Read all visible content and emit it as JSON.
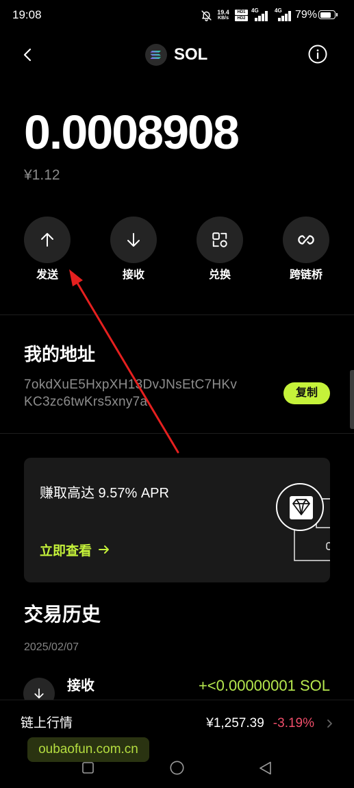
{
  "status_bar": {
    "time": "19:08",
    "net_speed": "19.4",
    "net_speed_unit": "KB/s",
    "hd_sim1": "HD1",
    "hd_sim2": "HD2",
    "sim1_network": "4G",
    "sim2_network": "4G",
    "battery_text": "79%",
    "battery_level_pct": 79,
    "icons": [
      "bell-off-icon",
      "signal-icon",
      "signal-icon",
      "battery-icon"
    ]
  },
  "header": {
    "back_icon": "chevron-left-icon",
    "token_icon": "solana-logo-icon",
    "title": "SOL",
    "info_icon": "info-icon"
  },
  "balance": {
    "amount": "0.0008908",
    "fiat_value": "¥1.12"
  },
  "actions": [
    {
      "label": "发送",
      "icon": "arrow-up-icon"
    },
    {
      "label": "接收",
      "icon": "arrow-down-icon"
    },
    {
      "label": "兑换",
      "icon": "swap-icon"
    },
    {
      "label": "跨链桥",
      "icon": "bridge-icon"
    }
  ],
  "address": {
    "title": "我的地址",
    "line1": "7okdXuE5HxpXH13DvJNsEtC7HKv",
    "line2": "KC3zc6twKrs5xny7a",
    "copy_label": "复制"
  },
  "promo": {
    "headline": "赚取高达 9.57% APR",
    "cta_label": "立即查看",
    "cta_icon": "arrow-right-icon",
    "illustration_icon": "diamond-icon"
  },
  "history": {
    "title": "交易历史",
    "groups": [
      {
        "date": "2025/02/07",
        "items": [
          {
            "type": "接收",
            "icon": "arrow-down-icon",
            "amount": "+<0.00000001 SOL"
          }
        ]
      }
    ]
  },
  "market": {
    "label": "链上行情",
    "price": "¥1,257.39",
    "change": "-3.19%",
    "chevron_icon": "chevron-right-icon"
  },
  "watermark": "oubaofun.com.cn",
  "nav_bar": {
    "icons": [
      "recents-square-icon",
      "home-circle-icon",
      "back-triangle-icon"
    ]
  },
  "colors": {
    "background": "#000000",
    "accent": "#c5f23a",
    "positive": "#b6e84e",
    "negative": "#f04e6a",
    "muted_text": "#8a8a8a",
    "annotation_arrow": "#e5201f"
  }
}
